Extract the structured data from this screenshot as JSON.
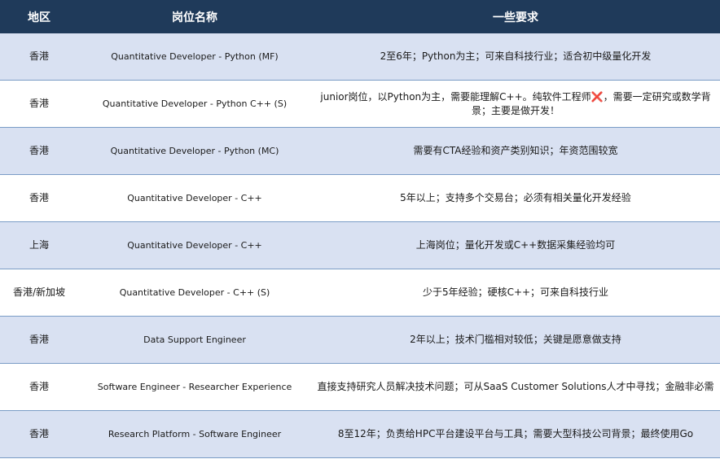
{
  "headers": [
    "地区",
    "岗位名称",
    "一些要求"
  ],
  "rows": [
    {
      "region": "香港",
      "title": "Quantitative Developer - Python (MF)",
      "req": "2至6年；Python为主；可来自科技行业；适合初中级量化开发"
    },
    {
      "region": "香港",
      "title": "Quantitative Developer - Python C++ (S)",
      "req": "junior岗位，以Python为主，需要能理解C++。纯软件工程师❌，需要一定研究或数学背景；主要是做开发！"
    },
    {
      "region": "香港",
      "title": "Quantitative Developer - Python (MC)",
      "req": "需要有CTA经验和资产类别知识；年资范围较宽"
    },
    {
      "region": "香港",
      "title": "Quantitative Developer - C++",
      "req": "5年以上；支持多个交易台；必须有相关量化开发经验"
    },
    {
      "region": "上海",
      "title": "Quantitative Developer - C++",
      "req": "上海岗位；量化开发或C++数据采集经验均可"
    },
    {
      "region": "香港/新加坡",
      "title": "Quantitative Developer - C++ (S)",
      "req": "少于5年经验；硬核C++；可来自科技行业"
    },
    {
      "region": "香港",
      "title": "Data Support Engineer",
      "req": "2年以上；技术门槛相对较低；关键是愿意做支持"
    },
    {
      "region": "香港",
      "title": "Software Engineer - Researcher Experience",
      "req": "直接支持研究人员解决技术问题；可从SaaS Customer Solutions人才中寻找；金融非必需"
    },
    {
      "region": "香港",
      "title": "Research Platform - Software Engineer",
      "req": "8至12年；负责给HPC平台建设平台与工具；需要大型科技公司背景；最终使用Go"
    }
  ]
}
